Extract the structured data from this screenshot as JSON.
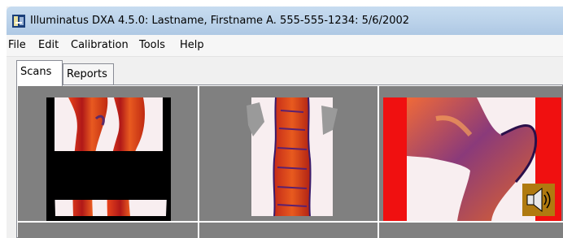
{
  "window": {
    "title": "Illuminatus DXA 4.5.0: Lastname, Firstname A. 555-555-1234: 5/6/2002"
  },
  "menu": {
    "items": [
      "File",
      "Edit",
      "Calibration",
      "Tools",
      "Help"
    ]
  },
  "tabs": [
    {
      "label": "Scans",
      "active": true
    },
    {
      "label": "Reports",
      "active": false
    }
  ],
  "scans": [
    {
      "region": "forearm"
    },
    {
      "region": "spine"
    },
    {
      "region": "hip"
    }
  ],
  "colors": {
    "title_gradient": "#bcd3ea",
    "scan_background": "#808080",
    "grid_line": "#ffffff",
    "bone_dark": "#3a1a6a",
    "bone_red": "#e03a1a",
    "hip_border": "#f01010"
  },
  "icons": {
    "app": "app-icon",
    "speaker": "speaker-icon"
  }
}
